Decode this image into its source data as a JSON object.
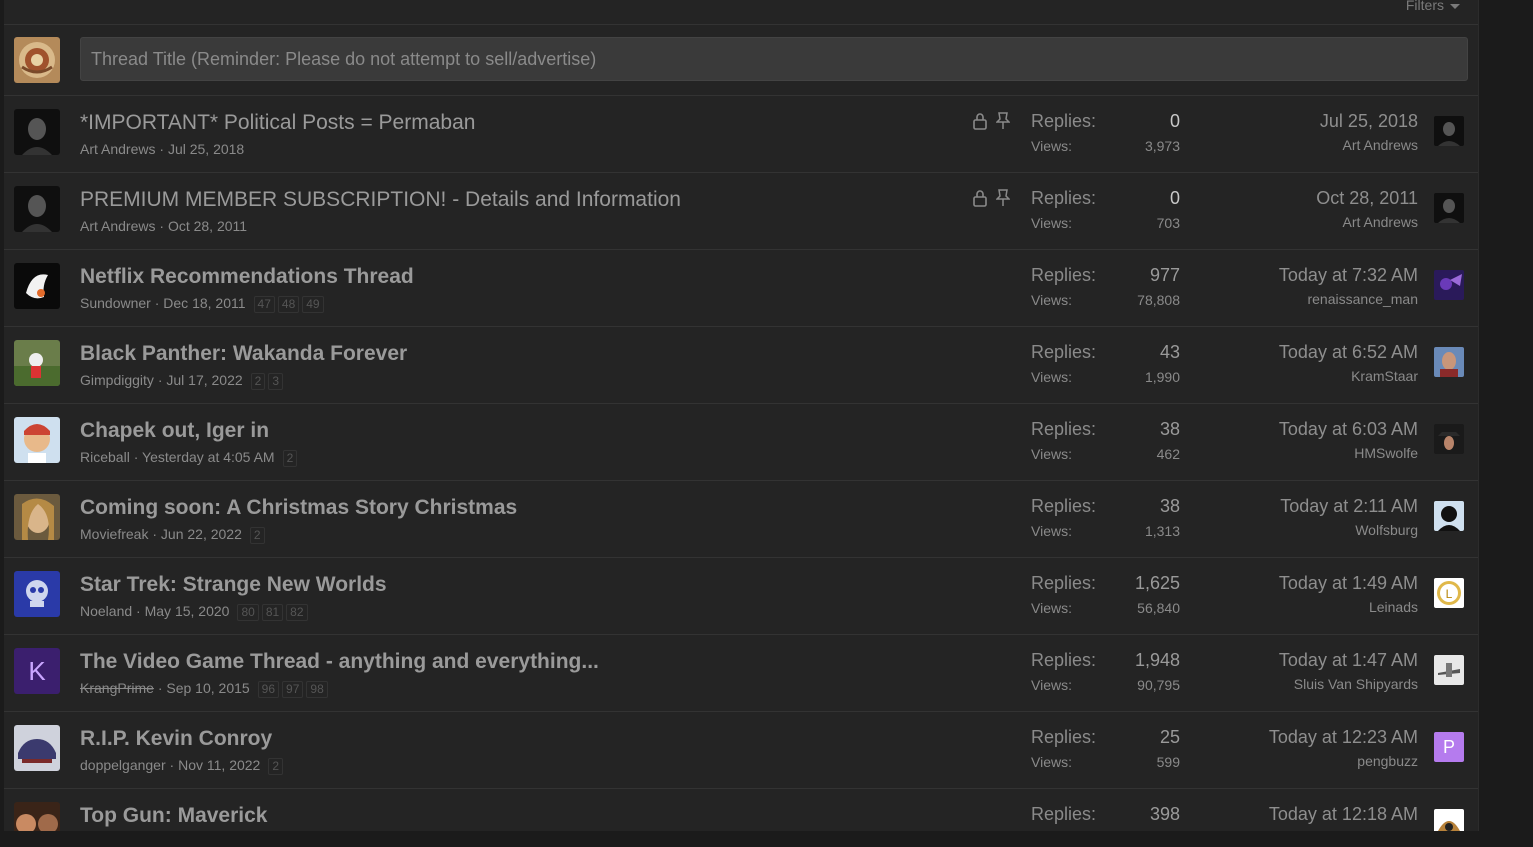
{
  "filters_label": "Filters",
  "new_thread": {
    "placeholder": "Thread Title (Reminder: Please do not attempt to sell/advertise)"
  },
  "labels": {
    "replies": "Replies:",
    "views": "Views:",
    "sep": "·"
  },
  "threads": [
    {
      "title": "*IMPORTANT* Political Posts = Permaban",
      "author": "Art Andrews",
      "date": "Jul 25, 2018",
      "pages": [],
      "replies": "0",
      "views": "3,973",
      "last_date": "Jul 25, 2018",
      "last_user": "Art Andrews",
      "locked": true,
      "sticky": true,
      "unread": false
    },
    {
      "title": "PREMIUM MEMBER SUBSCRIPTION! - Details and Information",
      "author": "Art Andrews",
      "date": "Oct 28, 2011",
      "pages": [],
      "replies": "0",
      "views": "703",
      "last_date": "Oct 28, 2011",
      "last_user": "Art Andrews",
      "locked": true,
      "sticky": true,
      "unread": false
    },
    {
      "title": "Netflix Recommendations Thread",
      "author": "Sundowner",
      "date": "Dec 18, 2011",
      "pages": [
        "47",
        "48",
        "49"
      ],
      "replies": "977",
      "views": "78,808",
      "last_date": "Today at 7:32 AM",
      "last_user": "renaissance_man",
      "locked": false,
      "sticky": false,
      "unread": true
    },
    {
      "title": "Black Panther: Wakanda Forever",
      "author": "Gimpdiggity",
      "date": "Jul 17, 2022",
      "pages": [
        "2",
        "3"
      ],
      "replies": "43",
      "views": "1,990",
      "last_date": "Today at 6:52 AM",
      "last_user": "KramStaar",
      "locked": false,
      "sticky": false,
      "unread": true
    },
    {
      "title": "Chapek out, Iger in",
      "author": "Riceball",
      "date": "Yesterday at 4:05 AM",
      "pages": [
        "2"
      ],
      "replies": "38",
      "views": "462",
      "last_date": "Today at 6:03 AM",
      "last_user": "HMSwolfe",
      "locked": false,
      "sticky": false,
      "unread": true
    },
    {
      "title": "Coming soon: A Christmas Story Christmas",
      "author": "Moviefreak",
      "date": "Jun 22, 2022",
      "pages": [
        "2"
      ],
      "replies": "38",
      "views": "1,313",
      "last_date": "Today at 2:11 AM",
      "last_user": "Wolfsburg",
      "locked": false,
      "sticky": false,
      "unread": true
    },
    {
      "title": "Star Trek: Strange New Worlds",
      "author": "Noeland",
      "date": "May 15, 2020",
      "pages": [
        "80",
        "81",
        "82"
      ],
      "replies": "1,625",
      "views": "56,840",
      "last_date": "Today at 1:49 AM",
      "last_user": "Leinads",
      "locked": false,
      "sticky": false,
      "unread": true
    },
    {
      "title": "The Video Game Thread - anything and everything...",
      "author": "KrangPrime",
      "date": "Sep 10, 2015",
      "pages": [
        "96",
        "97",
        "98"
      ],
      "replies": "1,948",
      "views": "90,795",
      "last_date": "Today at 1:47 AM",
      "last_user": "Sluis Van Shipyards",
      "locked": false,
      "sticky": false,
      "unread": true,
      "author_struck": true,
      "avatar_letter": "K"
    },
    {
      "title": "R.I.P. Kevin Conroy",
      "author": "doppelganger",
      "date": "Nov 11, 2022",
      "pages": [
        "2"
      ],
      "replies": "25",
      "views": "599",
      "last_date": "Today at 12:23 AM",
      "last_user": "pengbuzz",
      "locked": false,
      "sticky": false,
      "unread": true,
      "last_avatar_letter": "P"
    },
    {
      "title": "Top Gun: Maverick",
      "author": "",
      "date": "",
      "pages": [],
      "replies": "398",
      "views": "",
      "last_date": "Today at 12:18 AM",
      "last_user": "",
      "locked": false,
      "sticky": false,
      "unread": true
    }
  ],
  "colors": {
    "background": "#242424",
    "input": "#3a3a3a",
    "avatar_purple": "#3b1f6e",
    "avatar_lavender": "#b57bee"
  }
}
